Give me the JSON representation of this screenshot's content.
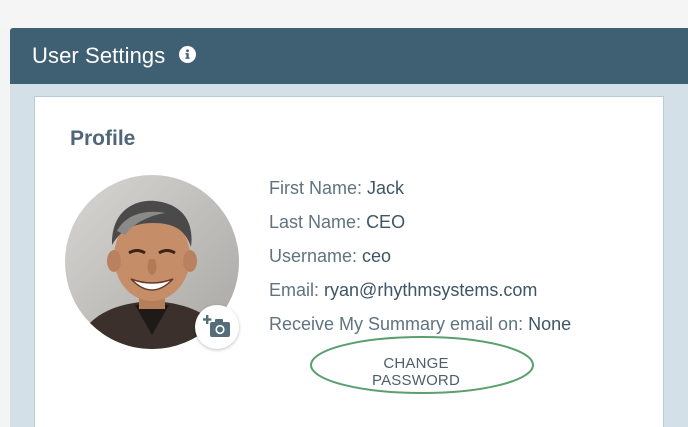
{
  "header": {
    "title": "User Settings",
    "info_icon": "info-icon"
  },
  "profile": {
    "heading": "Profile",
    "camera_icon": "add-photo-camera-icon",
    "fields": [
      {
        "label": "First Name:",
        "value": "Jack"
      },
      {
        "label": "Last Name:",
        "value": "CEO"
      },
      {
        "label": "Username:",
        "value": "ceo"
      },
      {
        "label": "Email:",
        "value": "ryan@rhythmsystems.com"
      },
      {
        "label": "Receive My Summary email on:",
        "value": "None"
      }
    ],
    "change_password_label": "CHANGE PASSWORD"
  },
  "colors": {
    "header_bg": "#3f5f72",
    "content_bg": "#d3e0e8",
    "annotation_green": "#5aa06e"
  }
}
